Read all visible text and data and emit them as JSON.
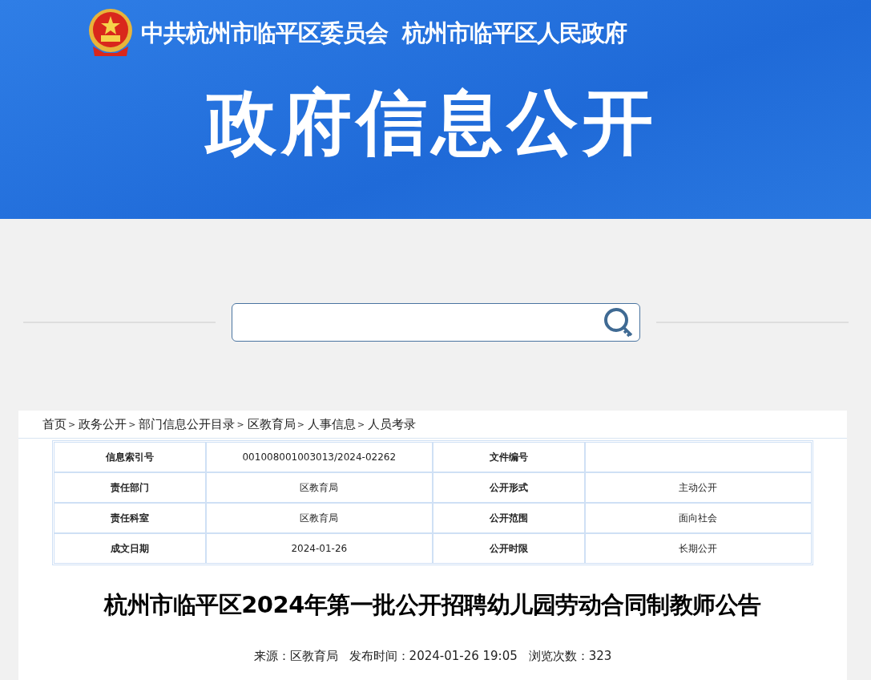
{
  "header": {
    "org_title": "中共杭州市临平区委员会  杭州市临平区人民政府",
    "banner_title": "政府信息公开"
  },
  "breadcrumb": {
    "separator": ">",
    "items": [
      "首页",
      "政务公开",
      "部门信息公开目录",
      "区教育局",
      "人事信息",
      "人员考录"
    ]
  },
  "info_table": {
    "rows": [
      {
        "label_1": "信息索引号",
        "value_1": "001008001003013/2024-02262",
        "label_2": "文件编号"
      },
      {
        "label_1": "责任部门",
        "value_1": "区教育局",
        "label_2": "公开形式",
        "value_2": "主动公开"
      },
      {
        "label_1": "责任科室",
        "value_1": "区教育局",
        "label_2": "公开范围",
        "value_2": "面向社会"
      },
      {
        "label_1": "成文日期",
        "value_1": "2024-01-26",
        "label_2": "公开时限",
        "value_2": "长期公开"
      }
    ]
  },
  "article": {
    "title": "杭州市临平区2024年第一批公开招聘幼儿园劳动合同制教师公告",
    "meta": [
      {
        "label": "来源：",
        "value": "区教育局"
      },
      {
        "label": "发布时间：",
        "value": "2024-01-26 19:05"
      },
      {
        "label": "浏览次数：",
        "value": "323"
      }
    ]
  }
}
